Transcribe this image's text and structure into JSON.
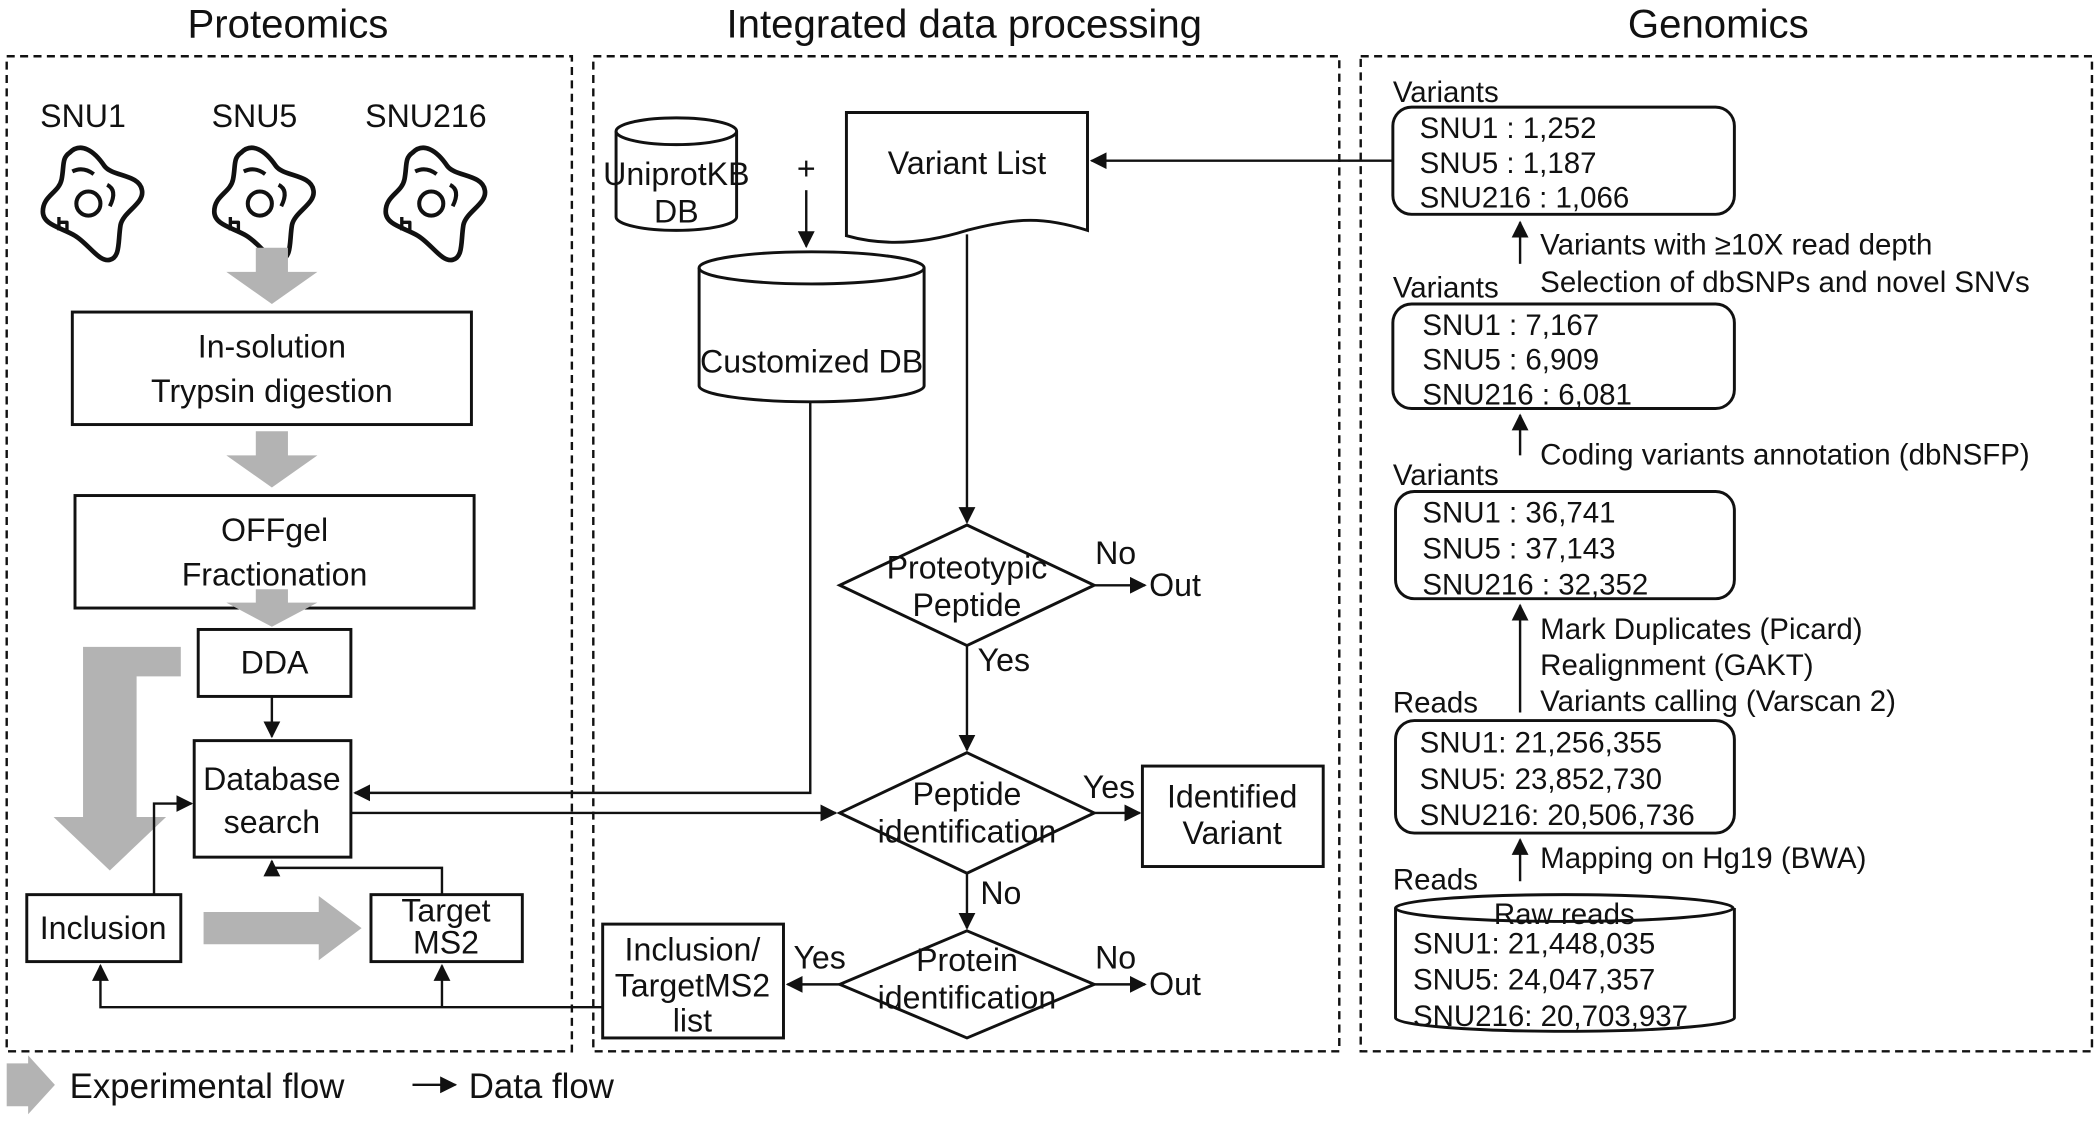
{
  "sections": {
    "proteomics": "Proteomics",
    "integrated": "Integrated data processing",
    "genomics": "Genomics"
  },
  "proteomics": {
    "cell_lines": [
      "SNU1",
      "SNU5",
      "SNU216"
    ],
    "digestion": [
      "In-solution",
      "Trypsin digestion"
    ],
    "fractionation": [
      "OFFgel",
      "Fractionation"
    ],
    "dda": "DDA",
    "database_search": [
      "Database",
      "search"
    ],
    "inclusion": "Inclusion",
    "target_ms2": [
      "Target",
      "MS2"
    ]
  },
  "integrated": {
    "uniprot_db": [
      "UniprotKB",
      "DB"
    ],
    "plus": "+",
    "variant_list": "Variant List",
    "customized_db": "Customized DB",
    "proteotypic": [
      "Proteotypic",
      "Peptide"
    ],
    "peptide_id": [
      "Peptide",
      "identification"
    ],
    "protein_id": [
      "Protein",
      "identification"
    ],
    "identified_variant": [
      "Identified",
      "Variant"
    ],
    "inclusion_list": [
      "Inclusion/",
      "TargetMS2",
      "list"
    ],
    "yes": "Yes",
    "no": "No",
    "out": "Out"
  },
  "genomics": {
    "variants_final": {
      "label": "Variants",
      "rows": [
        "SNU1 : 1,252",
        "SNU5 : 1,187",
        "SNU216 : 1,066"
      ]
    },
    "step_filter": [
      "Variants with ≥10X read depth",
      "Selection of dbSNPs and novel SNVs"
    ],
    "variants_coding": {
      "label": "Variants",
      "rows": [
        "SNU1 : 7,167",
        "SNU5 : 6,909",
        "SNU216 : 6,081"
      ]
    },
    "step_annotation": [
      "Coding variants annotation (dbNSFP)"
    ],
    "variants_called": {
      "label": "Variants",
      "rows": [
        "SNU1 : 36,741",
        "SNU5 : 37,143",
        "SNU216 : 32,352"
      ]
    },
    "step_calling": [
      "Mark Duplicates (Picard)",
      "Realignment (GAKT)",
      "Variants calling (Varscan 2)"
    ],
    "reads_mapped": {
      "label": "Reads",
      "rows": [
        "SNU1: 21,256,355",
        "SNU5: 23,852,730",
        "SNU216: 20,506,736"
      ]
    },
    "step_mapping": [
      "Mapping on Hg19 (BWA)"
    ],
    "reads_raw": {
      "label": "Reads",
      "title": "Raw reads",
      "rows": [
        "SNU1: 21,448,035",
        "SNU5: 24,047,357",
        "SNU216: 20,703,937"
      ]
    }
  },
  "legend": {
    "experimental": "Experimental flow",
    "data": "Data flow"
  },
  "colors": {
    "experimental_arrow": "#b3b3b3",
    "line": "#111111"
  }
}
